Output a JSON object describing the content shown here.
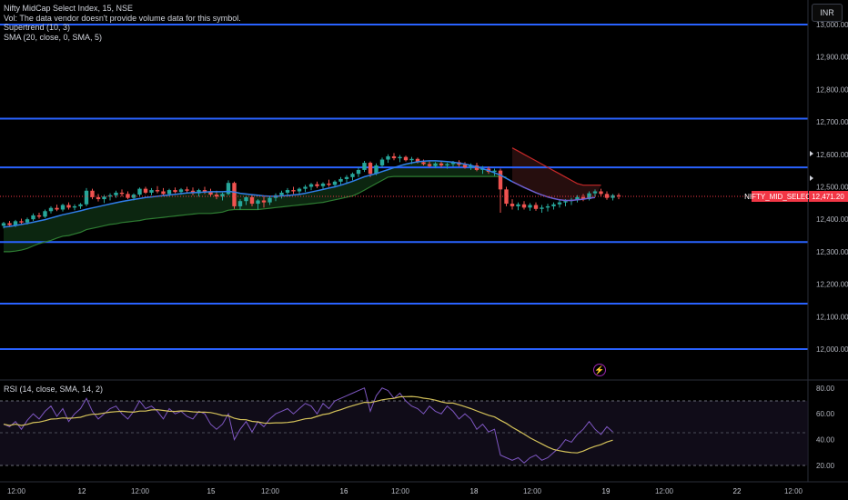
{
  "legend": {
    "symbol": "Nifty MidCap Select Index, 15, NSE",
    "vol": "Vol: The data vendor doesn't provide volume data for this symbol.",
    "supertrend": "Supertrend (10, 3)",
    "sma": "SMA (20, close, 0, SMA, 5)"
  },
  "currency": "INR",
  "rsi_legend": "RSI (14, close, SMA, 14, 2)",
  "last_price": {
    "label": "NIFTY_MID_SELECT",
    "value": "12,471.20",
    "color": "#f23645"
  },
  "colors": {
    "up": "#26a69a",
    "down": "#ef5350",
    "horizontal_lines": "#2962ff",
    "sma": "#2f7ee8",
    "supertrend_up": "#2e7d32",
    "supertrend_down": "#c62828",
    "rsi": "#7e57c2",
    "rsi_ma": "#d4c25a"
  },
  "icons": {
    "alert": "lightning-bolt-icon"
  },
  "price_axis": {
    "ticks": [
      "13,000.00",
      "12,900.00",
      "12,800.00",
      "12,700.00",
      "12,600.00",
      "12,500.00",
      "12,400.00",
      "12,300.00",
      "12,200.00",
      "12,100.00",
      "12,000.00"
    ]
  },
  "rsi_axis": {
    "ticks": [
      "80.00",
      "60.00",
      "40.00",
      "20.00"
    ]
  },
  "time_axis": {
    "ticks": [
      "12:00",
      "12",
      "12:00",
      "15",
      "12:00",
      "16",
      "12:00",
      "18",
      "12:00",
      "19",
      "12:00",
      "22",
      "12:00"
    ]
  },
  "chart_data": {
    "type": "candlestick",
    "horizontal_levels": [
      13000,
      12710,
      12560,
      12330,
      12140,
      12000
    ],
    "price_range": [
      12000,
      13000
    ],
    "x_ticks": [
      "12:00",
      "12",
      "12:00",
      "15",
      "12:00",
      "16",
      "12:00",
      "18",
      "12:00",
      "19",
      "12:00",
      "22",
      "12:00"
    ],
    "candles": [
      [
        12380,
        12392,
        12372,
        12388
      ],
      [
        12388,
        12395,
        12378,
        12382
      ],
      [
        12382,
        12398,
        12376,
        12394
      ],
      [
        12394,
        12402,
        12385,
        12390
      ],
      [
        12390,
        12405,
        12384,
        12400
      ],
      [
        12400,
        12418,
        12395,
        12412
      ],
      [
        12412,
        12420,
        12402,
        12408
      ],
      [
        12408,
        12430,
        12404,
        12425
      ],
      [
        12425,
        12440,
        12418,
        12435
      ],
      [
        12435,
        12445,
        12425,
        12430
      ],
      [
        12430,
        12448,
        12424,
        12444
      ],
      [
        12444,
        12452,
        12430,
        12436
      ],
      [
        12436,
        12446,
        12428,
        12440
      ],
      [
        12440,
        12450,
        12432,
        12446
      ],
      [
        12446,
        12496,
        12440,
        12488
      ],
      [
        12488,
        12494,
        12462,
        12468
      ],
      [
        12468,
        12478,
        12455,
        12462
      ],
      [
        12462,
        12475,
        12450,
        12470
      ],
      [
        12470,
        12480,
        12458,
        12474
      ],
      [
        12474,
        12488,
        12466,
        12482
      ],
      [
        12482,
        12492,
        12470,
        12478
      ],
      [
        12478,
        12486,
        12462,
        12466
      ],
      [
        12466,
        12480,
        12458,
        12476
      ],
      [
        12476,
        12498,
        12470,
        12494
      ],
      [
        12494,
        12500,
        12478,
        12482
      ],
      [
        12482,
        12496,
        12474,
        12490
      ],
      [
        12490,
        12502,
        12480,
        12486
      ],
      [
        12486,
        12496,
        12472,
        12478
      ],
      [
        12478,
        12494,
        12470,
        12490
      ],
      [
        12490,
        12498,
        12480,
        12484
      ],
      [
        12484,
        12496,
        12476,
        12492
      ],
      [
        12492,
        12500,
        12482,
        12488
      ],
      [
        12488,
        12498,
        12474,
        12480
      ],
      [
        12480,
        12494,
        12470,
        12490
      ],
      [
        12490,
        12500,
        12478,
        12484
      ],
      [
        12484,
        12494,
        12470,
        12476
      ],
      [
        12476,
        12488,
        12462,
        12470
      ],
      [
        12470,
        12482,
        12458,
        12478
      ],
      [
        12478,
        12520,
        12474,
        12512
      ],
      [
        12512,
        12516,
        12432,
        12440
      ],
      [
        12440,
        12462,
        12430,
        12456
      ],
      [
        12456,
        12472,
        12444,
        12468
      ],
      [
        12468,
        12476,
        12440,
        12448
      ],
      [
        12448,
        12462,
        12430,
        12458
      ],
      [
        12458,
        12470,
        12436,
        12452
      ],
      [
        12452,
        12470,
        12444,
        12466
      ],
      [
        12466,
        12480,
        12456,
        12474
      ],
      [
        12474,
        12488,
        12464,
        12482
      ],
      [
        12482,
        12496,
        12470,
        12490
      ],
      [
        12490,
        12500,
        12478,
        12486
      ],
      [
        12486,
        12498,
        12474,
        12494
      ],
      [
        12494,
        12506,
        12484,
        12500
      ],
      [
        12500,
        12512,
        12490,
        12508
      ],
      [
        12508,
        12516,
        12496,
        12502
      ],
      [
        12502,
        12514,
        12494,
        12510
      ],
      [
        12510,
        12522,
        12500,
        12506
      ],
      [
        12506,
        12520,
        12498,
        12516
      ],
      [
        12516,
        12530,
        12506,
        12524
      ],
      [
        12524,
        12536,
        12510,
        12530
      ],
      [
        12530,
        12544,
        12520,
        12540
      ],
      [
        12540,
        12560,
        12530,
        12552
      ],
      [
        12552,
        12580,
        12546,
        12574
      ],
      [
        12574,
        12578,
        12530,
        12540
      ],
      [
        12540,
        12572,
        12536,
        12566
      ],
      [
        12566,
        12590,
        12560,
        12584
      ],
      [
        12584,
        12600,
        12574,
        12594
      ],
      [
        12594,
        12604,
        12582,
        12588
      ],
      [
        12588,
        12598,
        12576,
        12592
      ],
      [
        12592,
        12596,
        12578,
        12582
      ],
      [
        12582,
        12592,
        12570,
        12586
      ],
      [
        12586,
        12590,
        12572,
        12576
      ],
      [
        12576,
        12584,
        12566,
        12570
      ],
      [
        12570,
        12578,
        12560,
        12564
      ],
      [
        12564,
        12576,
        12558,
        12572
      ],
      [
        12572,
        12578,
        12560,
        12566
      ],
      [
        12566,
        12574,
        12556,
        12570
      ],
      [
        12570,
        12580,
        12562,
        12576
      ],
      [
        12576,
        12582,
        12562,
        12568
      ],
      [
        12568,
        12576,
        12556,
        12560
      ],
      [
        12560,
        12572,
        12552,
        12566
      ],
      [
        12566,
        12574,
        12548,
        12552
      ],
      [
        12552,
        12564,
        12540,
        12556
      ],
      [
        12556,
        12562,
        12540,
        12546
      ],
      [
        12546,
        12556,
        12534,
        12550
      ],
      [
        12550,
        12556,
        12420,
        12492
      ],
      [
        12492,
        12500,
        12440,
        12448
      ],
      [
        12448,
        12462,
        12430,
        12440
      ],
      [
        12440,
        12452,
        12428,
        12446
      ],
      [
        12446,
        12456,
        12430,
        12436
      ],
      [
        12436,
        12450,
        12426,
        12444
      ],
      [
        12444,
        12452,
        12426,
        12432
      ],
      [
        12432,
        12444,
        12420,
        12436
      ],
      [
        12436,
        12448,
        12424,
        12440
      ],
      [
        12440,
        12452,
        12430,
        12446
      ],
      [
        12446,
        12458,
        12436,
        12452
      ],
      [
        12452,
        12462,
        12440,
        12456
      ],
      [
        12456,
        12466,
        12444,
        12460
      ],
      [
        12460,
        12474,
        12452,
        12468
      ],
      [
        12468,
        12478,
        12456,
        12462
      ],
      [
        12462,
        12486,
        12458,
        12480
      ],
      [
        12480,
        12492,
        12470,
        12486
      ],
      [
        12486,
        12494,
        12472,
        12478
      ],
      [
        12478,
        12486,
        12460,
        12466
      ],
      [
        12466,
        12478,
        12458,
        12474
      ],
      [
        12474,
        12480,
        12462,
        12471
      ]
    ],
    "sma_20": [
      12376,
      12378,
      12381,
      12384,
      12387,
      12391,
      12395,
      12399,
      12404,
      12409,
      12414,
      12418,
      12422,
      12426,
      12431,
      12435,
      12439,
      12443,
      12447,
      12451,
      12455,
      12458,
      12461,
      12464,
      12467,
      12469,
      12471,
      12473,
      12475,
      12477,
      12479,
      12481,
      12482,
      12483,
      12484,
      12485,
      12485,
      12485,
      12486,
      12484,
      12480,
      12478,
      12476,
      12474,
      12472,
      12471,
      12471,
      12472,
      12473,
      12475,
      12477,
      12480,
      12484,
      12488,
      12492,
      12496,
      12500,
      12505,
      12511,
      12517,
      12524,
      12531,
      12536,
      12541,
      12547,
      12553,
      12559,
      12565,
      12570,
      12574,
      12577,
      12579,
      12580,
      12580,
      12579,
      12578,
      12576,
      12573,
      12570,
      12566,
      12561,
      12556,
      12550,
      12543,
      12536,
      12526,
      12516,
      12507,
      12498,
      12490,
      12482,
      12475,
      12469,
      12464,
      12460,
      12458,
      12458,
      12460,
      12462,
      12465,
      12467
    ],
    "supertrend": [
      12300,
      12300,
      12302,
      12305,
      12310,
      12318,
      12325,
      12330,
      12335,
      12342,
      12348,
      12350,
      12355,
      12360,
      12368,
      12372,
      12376,
      12380,
      12384,
      12386,
      12390,
      12392,
      12394,
      12396,
      12400,
      12402,
      12404,
      12406,
      12408,
      12410,
      12412,
      12414,
      12416,
      12418,
      12418,
      12418,
      12420,
      12422,
      12428,
      12430,
      12430,
      12430,
      12430,
      12430,
      12432,
      12434,
      12436,
      12438,
      12440,
      12442,
      12444,
      12446,
      12448,
      12450,
      12452,
      12456,
      12460,
      12464,
      12468,
      12472,
      12480,
      12490,
      12500,
      12510,
      12520,
      12530,
      12532,
      12532,
      12532,
      12532,
      12532,
      12532,
      12532,
      12532,
      12532,
      12532,
      12532,
      12532,
      12532,
      12532,
      12532,
      12532,
      12532,
      12532,
      12532,
      12530,
      12620,
      12610,
      12600,
      12590,
      12580,
      12570,
      12560,
      12550,
      12540,
      12530,
      12520,
      12510,
      12505,
      12505,
      12505,
      12505
    ],
    "rsi": [
      52,
      50,
      54,
      48,
      55,
      60,
      56,
      62,
      66,
      58,
      64,
      54,
      60,
      64,
      72,
      62,
      56,
      60,
      64,
      66,
      60,
      56,
      62,
      70,
      64,
      66,
      62,
      56,
      64,
      60,
      62,
      58,
      56,
      62,
      60,
      52,
      48,
      52,
      60,
      40,
      48,
      54,
      46,
      54,
      50,
      56,
      60,
      62,
      64,
      60,
      64,
      68,
      66,
      60,
      68,
      64,
      70,
      72,
      74,
      76,
      78,
      80,
      62,
      74,
      80,
      78,
      72,
      76,
      70,
      66,
      64,
      60,
      66,
      62,
      60,
      66,
      62,
      56,
      60,
      56,
      48,
      52,
      46,
      48,
      28,
      26,
      24,
      26,
      22,
      26,
      28,
      24,
      26,
      30,
      34,
      40,
      38,
      44,
      48,
      54,
      48,
      44,
      50,
      46
    ]
  }
}
